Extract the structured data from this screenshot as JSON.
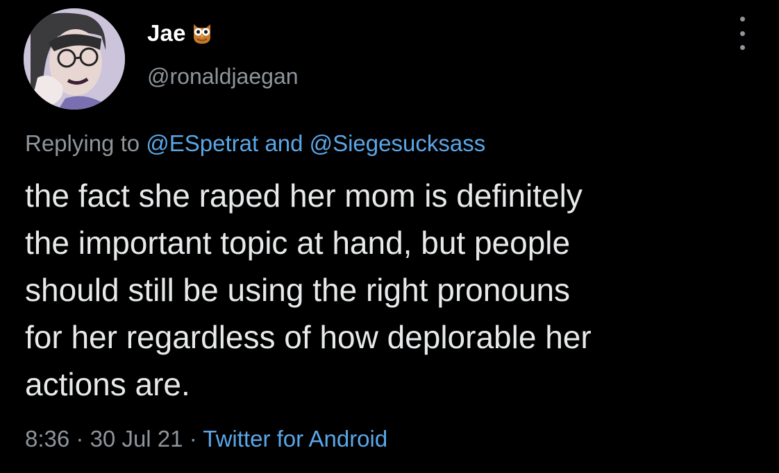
{
  "user": {
    "display_name": "Jae",
    "display_name_emoji": "owl-emoji",
    "handle": "@ronaldjaegan"
  },
  "reply": {
    "prefix": "Replying to",
    "mentions": [
      "@ESpetrat",
      "@Siegesucksass"
    ],
    "conjunction": "and"
  },
  "tweet": {
    "lines": [
      "the fact she raped her mom is definitely",
      "the important topic at hand, but people",
      "should still be using the right pronouns",
      "for her regardless of how deplorable her",
      "actions are."
    ]
  },
  "meta": {
    "time": "8:36",
    "separator": "·",
    "date": "30 Jul 21",
    "source": "Twitter for Android"
  },
  "icons": {
    "more": "more-vertical-icon",
    "avatar": "avatar"
  },
  "colors": {
    "background": "#000000",
    "text": "#e7e9ea",
    "secondary": "#8f959b",
    "link": "#5aa7e8"
  }
}
